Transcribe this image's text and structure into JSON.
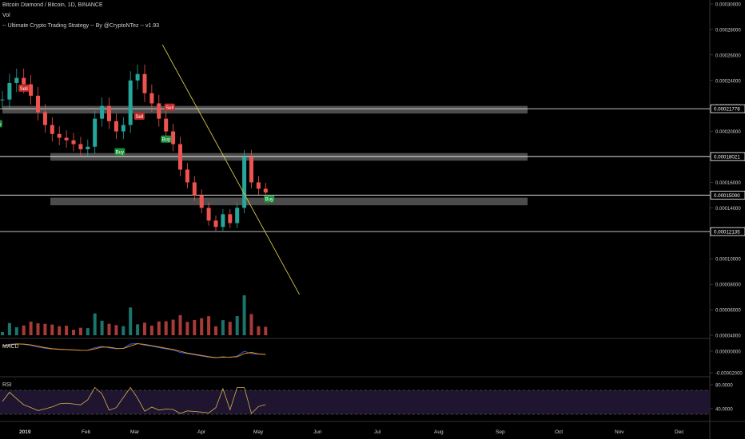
{
  "header": {
    "symbol_line": "Bitcoin Diamond / Bitcoin, 1D, BINANCE",
    "volume_label": "Vol",
    "strategy_line": "-- Ultimate Crypto Trading Strategy -- By @CryptoNTez -- v1.93"
  },
  "panes": {
    "macd_label": "MACD",
    "rsi_label": "RSI"
  },
  "colors": {
    "background": "#000000",
    "up": "#26a69a",
    "down": "#ef5350",
    "trendline": "#d4c84a",
    "macd_line": "#2962ff",
    "signal_line": "#ff9800",
    "rsi_line": "#d4b24a",
    "rsi_band": "#1f1530",
    "zone": "#8a8a8a",
    "buy_bg": "#1b8f3a",
    "sell_bg": "#c62828"
  },
  "chart_data": {
    "type": "candlestick",
    "title": "Bitcoin Diamond / Bitcoin, 1D, BINANCE",
    "price_axis_ticks": [
      "0.00030000",
      "0.00028000",
      "0.00026000",
      "0.00024000",
      "0.00022000",
      "0.00020000",
      "0.00018000",
      "0.00016000",
      "0.00014000",
      "0.00012000",
      "0.00010000",
      "0.00008000",
      "0.00006000",
      "0.00004000"
    ],
    "price_axis_range": [
      4e-05,
      0.0003
    ],
    "price_tags": [
      "0.00021778",
      "0.00018021",
      "0.00015000",
      "0.00012135"
    ],
    "x_ticks": [
      "2019",
      "Feb",
      "Mar",
      "Apr",
      "May",
      "Jun",
      "Jul",
      "Aug",
      "Sep",
      "Oct",
      "Nov",
      "Dec"
    ],
    "signals": [
      {
        "label": "Sell",
        "date": "2019-01-13",
        "price": 0.000234
      },
      {
        "label": "Sell",
        "date": "2019-03-19",
        "price": 0.000212
      },
      {
        "label": "Sell",
        "date": "2019-04-05",
        "price": 0.000219
      },
      {
        "label": "Buy",
        "date": "2019-03-08",
        "price": 0.000184
      },
      {
        "label": "Buy",
        "date": "2019-04-03",
        "price": 0.000194
      },
      {
        "label": "Buy",
        "date": "2019-05-31",
        "price": 0.000147
      },
      {
        "label": "Buy",
        "date": "2018-12-29",
        "price": 0.000206
      }
    ],
    "zones": [
      [
        0.000214,
        0.00022
      ],
      [
        0.000177,
        0.000183
      ],
      [
        0.000142,
        0.000148
      ]
    ],
    "h_levels": [
      0.00021778,
      0.00018021,
      0.00015,
      0.00012135
    ],
    "trendline": {
      "from": {
        "date": "2019-04-01",
        "price": 0.000268
      },
      "to": {
        "date": "2019-06-17",
        "price": 7.2e-05
      }
    },
    "close_series": [
      0.000225,
      0.000238,
      0.000242,
      0.000237,
      0.000228,
      0.000215,
      0.000205,
      0.000198,
      0.000195,
      0.000193,
      0.00019,
      0.000186,
      0.000188,
      0.00021,
      0.00022,
      0.000208,
      0.0002,
      0.000205,
      0.00024,
      0.000245,
      0.00023,
      0.000222,
      0.00021,
      0.0002,
      0.00019,
      0.00017,
      0.00016,
      0.00015,
      0.00014,
      0.00013,
      0.000125,
      0.000135,
      0.000128,
      0.00014,
      0.00018,
      0.00016,
      0.000155,
      0.000152
    ],
    "close_dates_start": "2019-01-01",
    "close_step_days": 4,
    "macd": {
      "ticks": [
        "0.00000000",
        "-0.00002000"
      ]
    },
    "rsi": {
      "ticks": [
        "80.0000",
        "40.0000"
      ],
      "range": [
        0,
        100
      ]
    }
  }
}
